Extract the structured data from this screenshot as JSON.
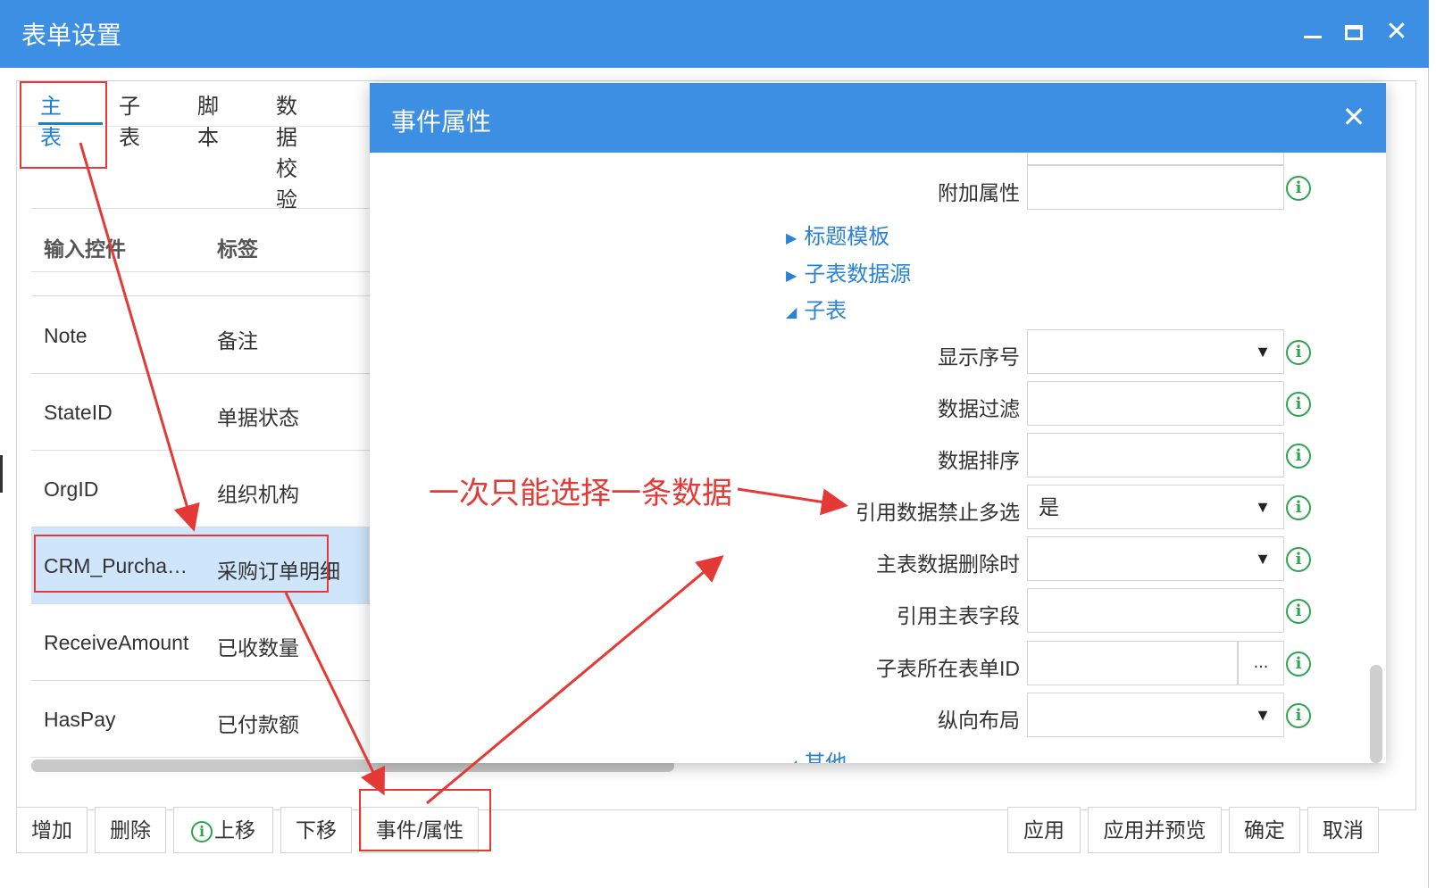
{
  "window": {
    "title": "表单设置",
    "controls": [
      "minimize",
      "maximize",
      "close"
    ]
  },
  "tabs": [
    {
      "label": "主表",
      "active": true
    },
    {
      "label": "子表",
      "active": false
    },
    {
      "label": "脚本",
      "active": false
    },
    {
      "label": "数据校验",
      "active": false
    }
  ],
  "table": {
    "columns": [
      "输入控件",
      "标签"
    ],
    "rows": [
      {
        "control": "Note",
        "label": "备注",
        "selected": false
      },
      {
        "control": "StateID",
        "label": "单据状态",
        "selected": false
      },
      {
        "control": "OrgID",
        "label": "组织机构",
        "selected": false
      },
      {
        "control": "CRM_Purcha…",
        "label": "采购订单明细",
        "selected": true
      },
      {
        "control": "ReceiveAmount",
        "label": "已收数量",
        "selected": false
      },
      {
        "control": "HasPay",
        "label": "已付款额",
        "selected": false
      }
    ]
  },
  "bottom_buttons": {
    "add": "增加",
    "delete": "删除",
    "move_up": "上移",
    "move_down": "下移",
    "event_property": "事件/属性",
    "apply": "应用",
    "apply_preview": "应用并预览",
    "ok": "确定",
    "cancel": "取消"
  },
  "dialog": {
    "title": "事件属性",
    "fields": {
      "extra_attr": {
        "label": "附加属性",
        "value": ""
      },
      "show_index": {
        "label": "显示序号",
        "value": ""
      },
      "data_filter": {
        "label": "数据过滤",
        "value": ""
      },
      "data_sort": {
        "label": "数据排序",
        "value": ""
      },
      "ref_no_multi": {
        "label": "引用数据禁止多选",
        "value": "是"
      },
      "on_master_delete": {
        "label": "主表数据删除时",
        "value": ""
      },
      "ref_master_field": {
        "label": "引用主表字段",
        "value": ""
      },
      "subtable_form_id": {
        "label": "子表所在表单ID",
        "value": "",
        "button": "..."
      },
      "vertical_layout": {
        "label": "纵向布局",
        "value": ""
      }
    },
    "sections": {
      "title_template": "标题模板",
      "subtable_datasource": "子表数据源",
      "subtable": "子表",
      "other": "其他"
    }
  },
  "annotation": {
    "text": "一次只能选择一条数据",
    "color": "#e53935"
  },
  "colors": {
    "titlebar": "#3d8fe3",
    "accent": "#1e7fd6",
    "selected_row": "#cfe5fb",
    "info_icon": "#2da44e"
  }
}
